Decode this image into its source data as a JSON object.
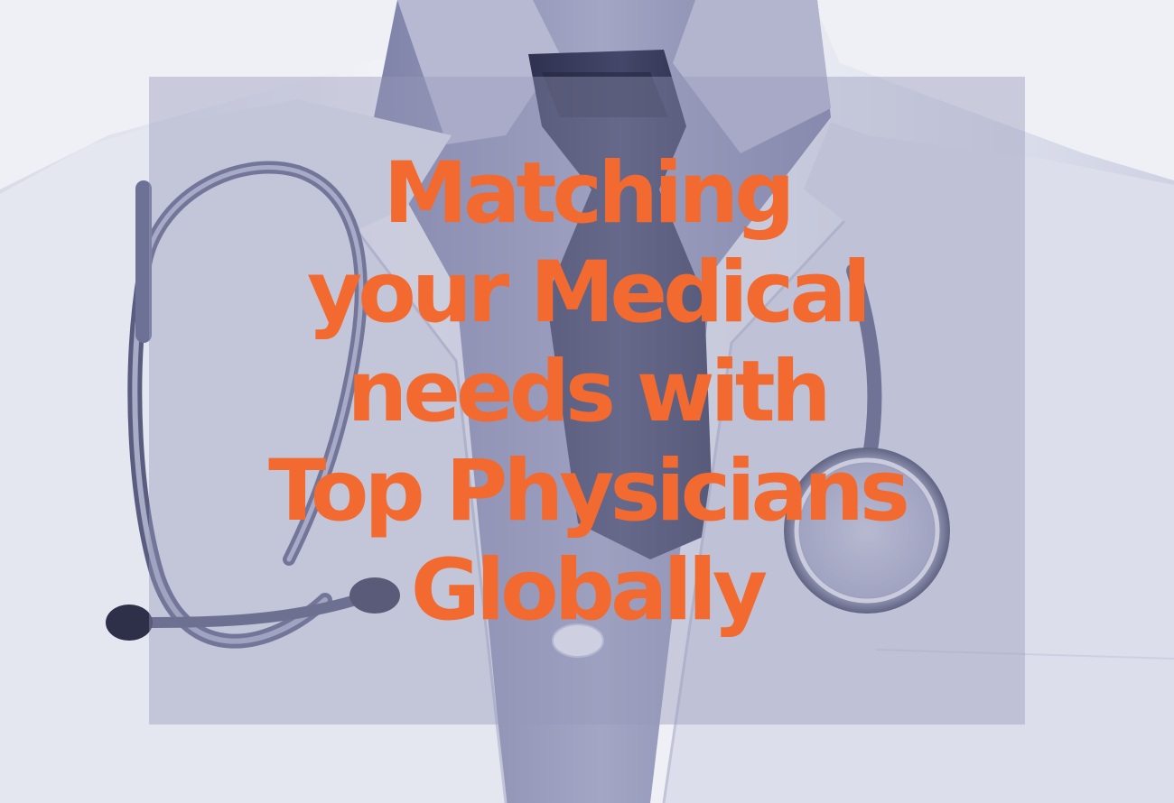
{
  "hero": {
    "headline_lines": [
      "Matching",
      "your Medical",
      "needs with",
      "Top Physicians",
      "Globally"
    ]
  },
  "colors": {
    "headline": "#f26a30",
    "overlay": "#9698b9",
    "photo_tint": "#8a8db5"
  },
  "image": {
    "subject": "doctor in white coat with stethoscope and dark tie"
  }
}
